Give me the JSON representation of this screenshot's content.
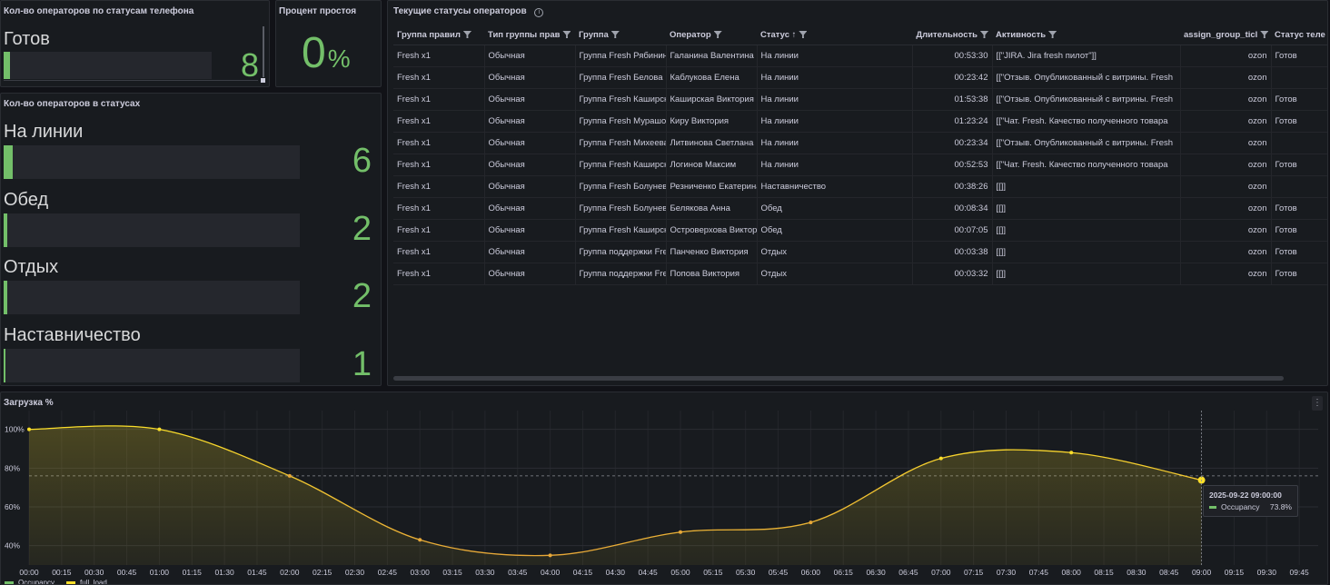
{
  "panels": {
    "phone_status": {
      "title": "Кол-во операторов по статусам телефона",
      "label": "Готов",
      "value": "8",
      "fraction": 0.03
    },
    "idle": {
      "title": "Процент простоя",
      "value": "0",
      "unit": "%"
    },
    "statuses": {
      "title": "Кол-во операторов в статусах",
      "items": [
        {
          "label": "На линии",
          "value": "6",
          "fraction": 0.03
        },
        {
          "label": "Обед",
          "value": "2",
          "fraction": 0.012
        },
        {
          "label": "Отдых",
          "value": "2",
          "fraction": 0.012
        },
        {
          "label": "Наставничество",
          "value": "1",
          "fraction": 0.006
        }
      ]
    },
    "table": {
      "title": "Текущие статусы операторов",
      "columns": [
        "Группа правил",
        "Тип группы прав",
        "Группа",
        "Оператор",
        "Статус",
        "Длительность",
        "Активность",
        "assign_group_ticl",
        "Статус теле"
      ],
      "rows": [
        [
          "Fresh x1",
          "Обычная",
          "Группа Fresh Рябинина",
          "Галанина Валентина",
          "На линии",
          "00:53:30",
          "[[\"JIRA. Jira fresh пилот\"]]",
          "ozon",
          "Готов"
        ],
        [
          "Fresh x1",
          "Обычная",
          "Группа Fresh Белова",
          "Каблукова Елена",
          "На линии",
          "00:23:42",
          "[[\"Отзыв. Опубликованный с витрины. Fresh",
          "ozon",
          ""
        ],
        [
          "Fresh x1",
          "Обычная",
          "Группа Fresh Каширская",
          "Каширская Виктория",
          "На линии",
          "01:53:38",
          "[[\"Отзыв. Опубликованный с витрины. Fresh",
          "ozon",
          "Готов"
        ],
        [
          "Fresh x1",
          "Обычная",
          "Группа Fresh Мурашова",
          "Киру Виктория",
          "На линии",
          "01:23:24",
          "[[\"Чат. Fresh. Качество полученного товара",
          "ozon",
          "Готов"
        ],
        [
          "Fresh x1",
          "Обычная",
          "Группа Fresh Михеева",
          "Литвинова Светлана",
          "На линии",
          "00:23:34",
          "[[\"Отзыв. Опубликованный с витрины. Fresh",
          "ozon",
          ""
        ],
        [
          "Fresh x1",
          "Обычная",
          "Группа Fresh Каширская",
          "Логинов Максим",
          "На линии",
          "00:52:53",
          "[[\"Чат. Fresh. Качество полученного товара",
          "ozon",
          "Готов"
        ],
        [
          "Fresh x1",
          "Обычная",
          "Группа Fresh Болунева",
          "Резниченко Екатерина",
          "Наставничество",
          "00:38:26",
          "[[]]",
          "ozon",
          ""
        ],
        [
          "Fresh x1",
          "Обычная",
          "Группа Fresh Болунева",
          "Белякова Анна",
          "Обед",
          "00:08:34",
          "[[]]",
          "ozon",
          "Готов"
        ],
        [
          "Fresh x1",
          "Обычная",
          "Группа Fresh Каширская",
          "Островерхова Виктория",
          "Обед",
          "00:07:05",
          "[[]]",
          "ozon",
          "Готов"
        ],
        [
          "Fresh x1",
          "Обычная",
          "Группа поддержки Fresh",
          "Панченко Виктория",
          "Отдых",
          "00:03:38",
          "[[]]",
          "ozon",
          "Готов"
        ],
        [
          "Fresh x1",
          "Обычная",
          "Группа поддержки Fresh",
          "Попова Виктория",
          "Отдых",
          "00:03:32",
          "[[]]",
          "ozon",
          "Готов"
        ]
      ]
    },
    "load": {
      "title": "Загрузка %",
      "tooltip_time": "2025-09-22 09:00:00",
      "tooltip_series": "Occupancy",
      "tooltip_value": "73.8%"
    }
  },
  "colors": {
    "green": "#73bf69",
    "yellow": "#fade2a",
    "orange": "#e8a838"
  },
  "chart_data": {
    "type": "line",
    "x": [
      "00:00",
      "01:00",
      "02:00",
      "03:00",
      "04:00",
      "05:00",
      "06:00",
      "07:00",
      "08:00",
      "09:00"
    ],
    "series": [
      {
        "name": "Occupancy",
        "values": [
          100,
          100,
          76,
          43,
          35,
          47,
          52,
          85,
          88,
          73.8
        ]
      }
    ],
    "threshold": 76,
    "x_ticks": [
      "00:00",
      "00:15",
      "00:30",
      "00:45",
      "01:00",
      "01:15",
      "01:30",
      "01:45",
      "02:00",
      "02:15",
      "02:30",
      "02:45",
      "03:00",
      "03:15",
      "03:30",
      "03:45",
      "04:00",
      "04:15",
      "04:30",
      "04:45",
      "05:00",
      "05:15",
      "05:30",
      "05:45",
      "06:00",
      "06:15",
      "06:30",
      "06:45",
      "07:00",
      "07:15",
      "07:30",
      "07:45",
      "08:00",
      "08:15",
      "08:30",
      "08:45",
      "09:00",
      "09:15",
      "09:30",
      "09:45"
    ],
    "y_ticks": [
      "40%",
      "60%",
      "80%",
      "100%"
    ],
    "ylim": [
      30,
      105
    ],
    "legend": [
      "Occupancy",
      "full_load"
    ]
  }
}
